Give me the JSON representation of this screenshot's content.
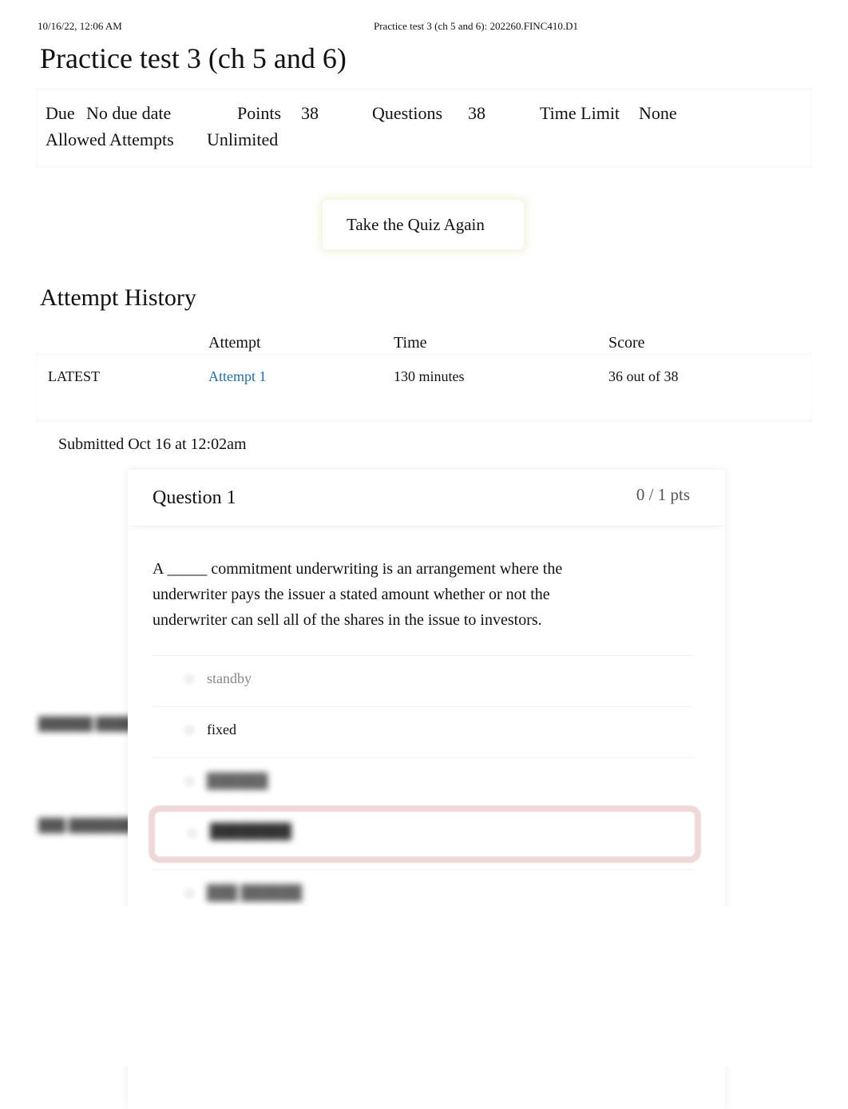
{
  "print_header": {
    "datetime": "10/16/22, 12:06 AM",
    "page_title": "Practice test 3 (ch 5 and 6): 202260.FINC410.D1"
  },
  "quiz": {
    "title": "Practice test 3 (ch 5 and 6)",
    "details": {
      "due_label": "Due",
      "due_value": "No due date",
      "points_label": "Points",
      "points_value": "38",
      "questions_label": "Questions",
      "questions_value": "38",
      "time_limit_label": "Time Limit",
      "time_limit_value": "None",
      "allowed_attempts_label": "Allowed Attempts",
      "allowed_attempts_value": "Unlimited"
    },
    "retake_button": "Take the Quiz Again"
  },
  "attempt_history": {
    "title": "Attempt History",
    "columns": [
      "",
      "Attempt",
      "Time",
      "Score"
    ],
    "rows": [
      {
        "tag": "LATEST",
        "attempt": "Attempt 1",
        "time": "130 minutes",
        "score": "36 out of 38"
      }
    ]
  },
  "submission": {
    "submitted_text": "Submitted Oct 16 at 12:02am"
  },
  "questions": [
    {
      "title": "Question 1",
      "points": "0 / 1 pts",
      "text": "A _____ commitment underwriting is an arrangement where the underwriter pays the issuer a stated amount whether or not the underwriter can sell all of the shares in the issue to investors.",
      "answers": [
        {
          "label": "standby",
          "state": "unselected-muted"
        },
        {
          "label": "fixed",
          "state": "unselected"
        },
        {
          "label": "",
          "state": "blurred"
        },
        {
          "label": "",
          "state": "selected-incorrect-blurred"
        },
        {
          "label": "",
          "state": "blurred"
        }
      ]
    }
  ],
  "colors": {
    "link": "#1f6fb2",
    "incorrect_border": "#f0d8d8",
    "muted_text": "#888888"
  }
}
